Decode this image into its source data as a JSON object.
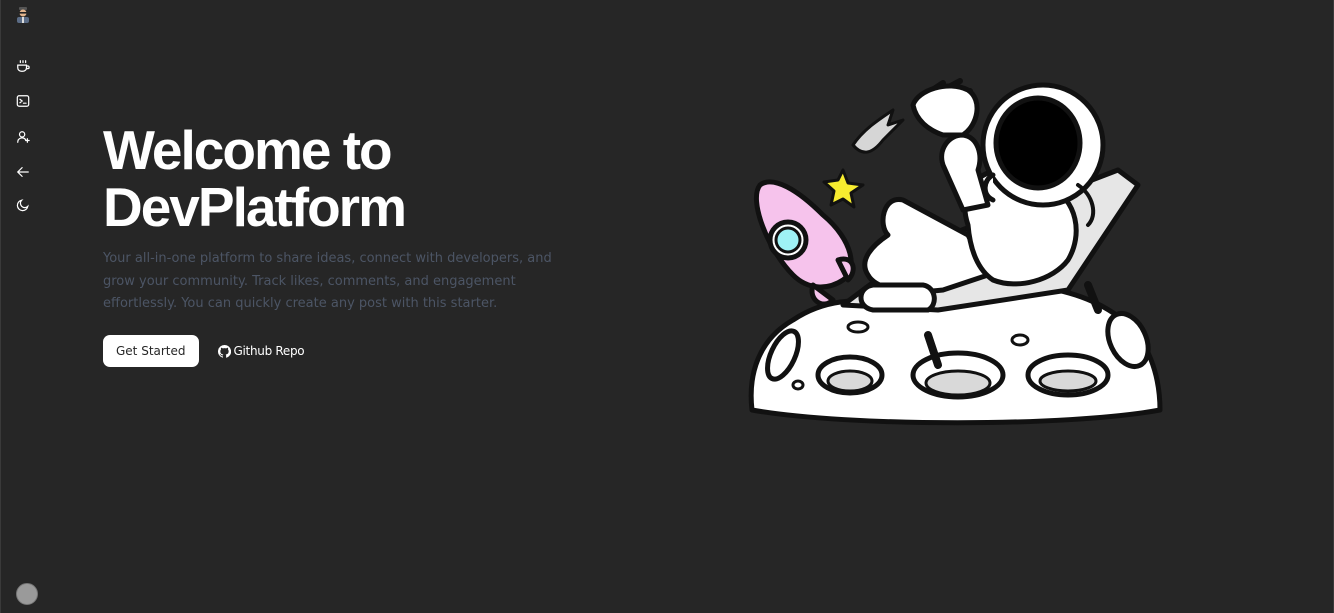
{
  "sidebar": {
    "logo_icon": "developer-avatar-logo",
    "items": [
      {
        "icon": "coffee-icon"
      },
      {
        "icon": "terminal-icon"
      },
      {
        "icon": "user-plus-icon"
      },
      {
        "icon": "arrow-left-icon"
      },
      {
        "icon": "moon-icon"
      }
    ],
    "avatar_icon": "user-avatar"
  },
  "hero": {
    "title_line1": "Welcome to",
    "title_line2": "DevPlatform",
    "description": "Your all-in-one platform to share ideas, connect with developers, and grow your community. Track likes, comments, and engagement effortlessly. You can quickly create any post with this starter.",
    "primary_button": "Get Started",
    "secondary_button": "Github Repo",
    "secondary_icon": "github-icon"
  },
  "illustration": {
    "subject": "astronaut-relaxing-on-moon",
    "colors": {
      "outline": "#111111",
      "fill": "#ffffff",
      "rocket": "#f6c3ec",
      "window": "#9ff2f5",
      "star": "#f7ec2f"
    }
  }
}
